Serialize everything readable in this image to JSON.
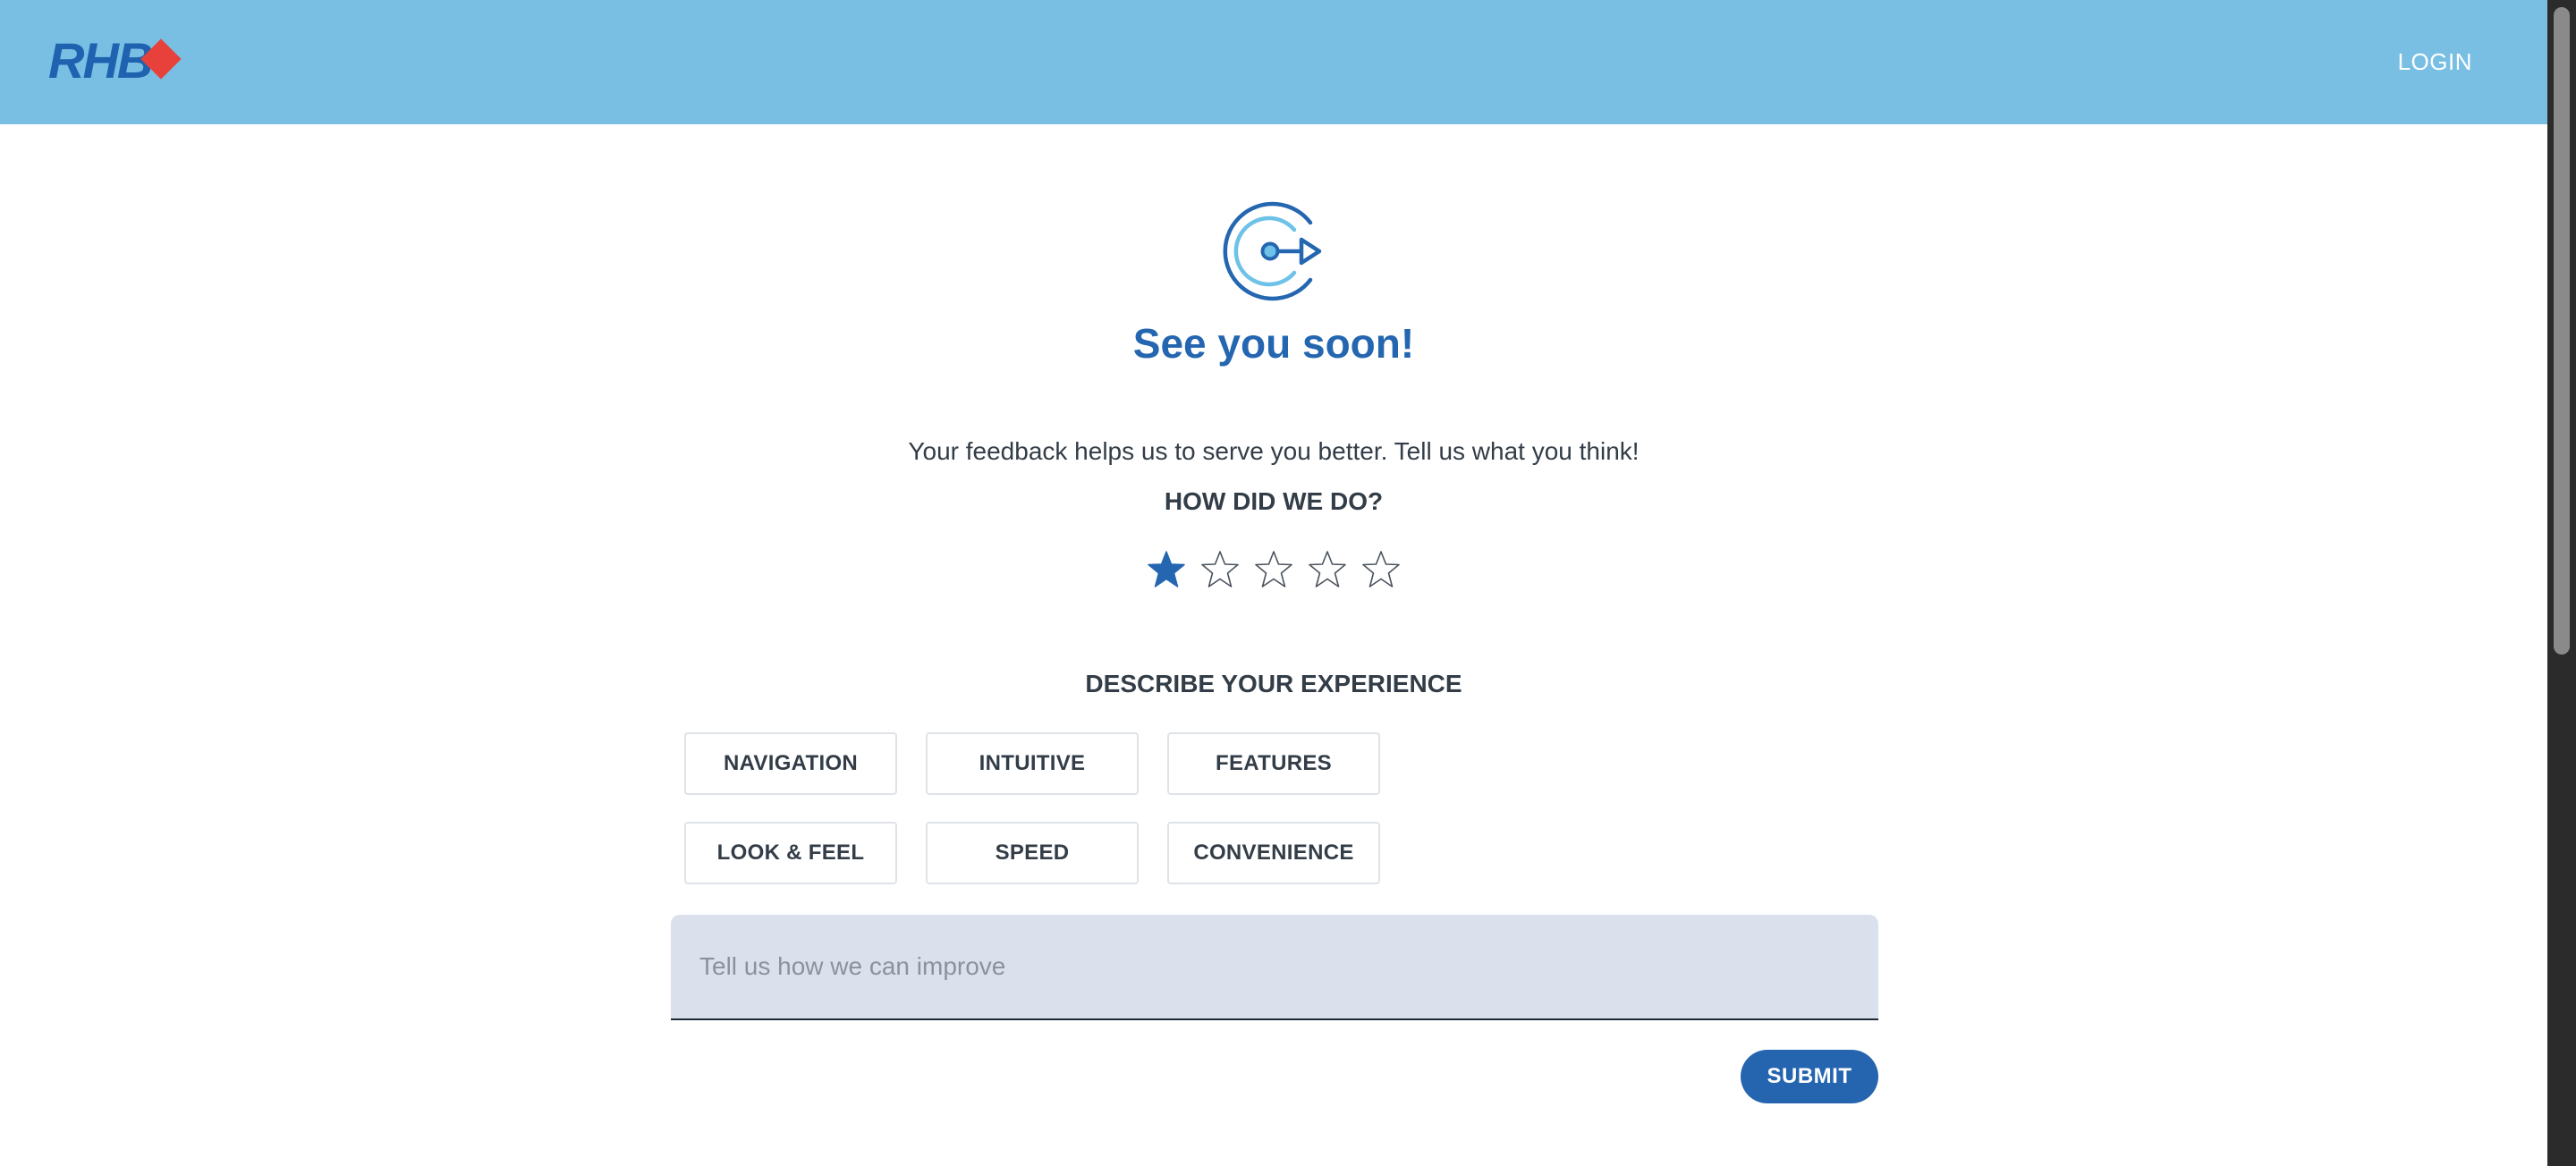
{
  "header": {
    "logo_text": "RHB",
    "login_label": "LOGIN",
    "background_color": "#78bfe3"
  },
  "main": {
    "icon": "logout-icon",
    "title": "See you soon!",
    "subtitle": "Your feedback helps us to serve you better. Tell us what you think!",
    "rating_heading": "HOW DID WE DO?",
    "rating": {
      "value": 1,
      "max": 5
    },
    "describe_heading": "DESCRIBE YOUR EXPERIENCE",
    "experience_options": [
      {
        "label": "NAVIGATION"
      },
      {
        "label": "INTUITIVE"
      },
      {
        "label": "FEATURES"
      },
      {
        "label": "LOOK & FEEL"
      },
      {
        "label": "SPEED"
      },
      {
        "label": "CONVENIENCE"
      }
    ],
    "comment_placeholder": "Tell us how we can improve",
    "comment_value": "",
    "submit_label": "SUBMIT"
  },
  "colors": {
    "primary": "#2466b0",
    "brand_red": "#e8413b",
    "input_bg": "#dae1ec"
  }
}
